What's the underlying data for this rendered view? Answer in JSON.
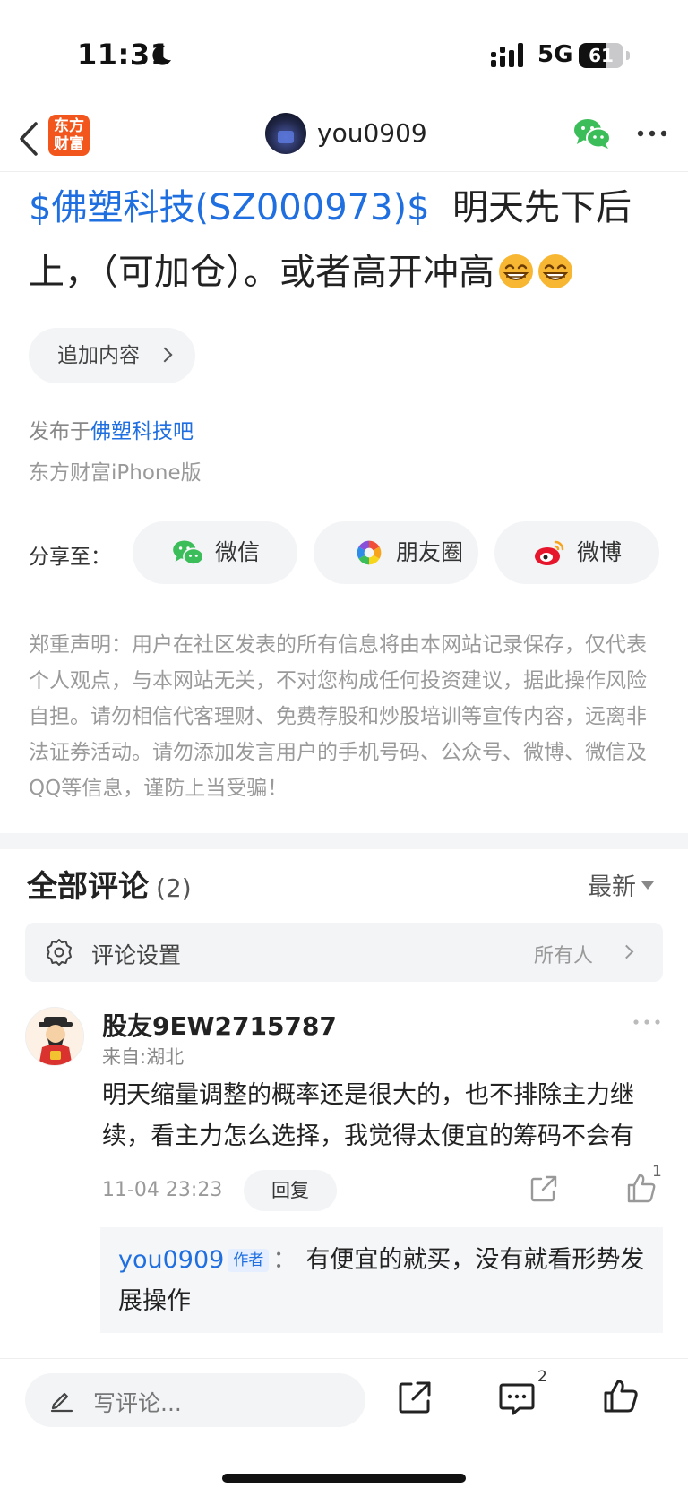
{
  "status_bar": {
    "time": "11:31",
    "network": "5G",
    "battery": "61",
    "battery_level": 0.61
  },
  "nav": {
    "logo_text_1": "东方",
    "logo_text_2": "财富",
    "username": "you0909"
  },
  "post": {
    "stock_link": "$佛塑科技(SZ000973)$",
    "text": "明天先下后上，（可加仓）。或者高开冲高"
  },
  "append_label": "追加内容",
  "published_prefix": "发布于",
  "published_bar": "佛塑科技吧",
  "client": "东方财富iPhone版",
  "share": {
    "label": "分享至：",
    "wechat": "微信",
    "moments": "朋友圈",
    "weibo": "微博"
  },
  "disclaimer": "郑重声明：用户在社区发表的所有信息将由本网站记录保存，仅代表个人观点，与本网站无关，不对您构成任何投资建议，据此操作风险自担。请勿相信代客理财、免费荐股和炒股培训等宣传内容，远离非法证券活动。请勿添加发言用户的手机号码、公众号、微博、微信及QQ等信息，谨防上当受骗！",
  "comments": {
    "title": "全部评论",
    "count": "(2)",
    "sort": "最新",
    "settings_label": "评论设置",
    "settings_value": "所有人",
    "items": [
      {
        "name": "股友9EW2715787",
        "location": "来自:湖北",
        "text": "明天缩量调整的概率还是很大的，也不排除主力继续，看主力怎么选择，我觉得太便宜的筹码不会有",
        "time": "11-04 23:23",
        "reply_label": "回复",
        "likes": "1",
        "reply": {
          "name": "you0909",
          "tag": "作者",
          "colon": "：",
          "text": "有便宜的就买，没有就看形势发展操作"
        }
      }
    ]
  },
  "toolbar": {
    "placeholder": "写评论...",
    "comment_count": "2"
  }
}
